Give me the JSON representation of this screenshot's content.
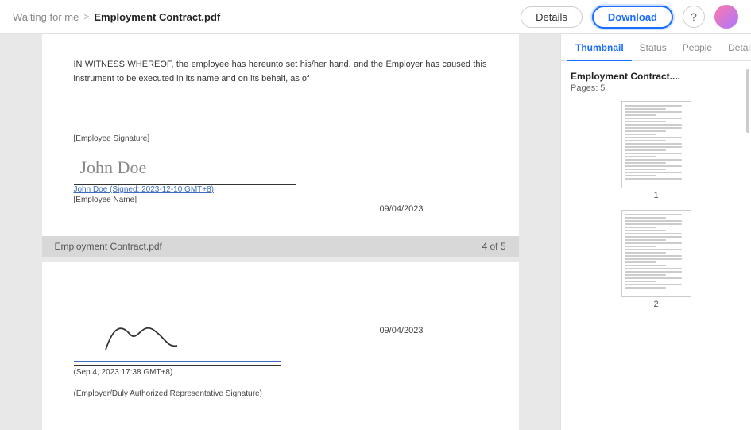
{
  "header": {
    "breadcrumb_waiting": "Waiting for me",
    "breadcrumb_sep": ">",
    "filename": "Employment Contract.pdf",
    "btn_details": "Details",
    "btn_download": "Download",
    "help_icon": "?",
    "tabs": [
      "Thumbnail",
      "Status",
      "People",
      "Details"
    ],
    "active_tab": "Thumbnail"
  },
  "thumbnail": {
    "title": "Employment Contract....",
    "pages_label": "Pages: 5",
    "page_numbers": [
      "1",
      "2"
    ]
  },
  "document": {
    "page4": {
      "intro_text": "IN WITNESS WHEREOF, the employee has hereunto set his/her hand, and the Employer has caused this instrument to be executed in its name and on its behalf, as of",
      "underline_placeholder": "________________________.",
      "employee_sig_label": "[Employee Signature]",
      "employee_name": "John Doe",
      "signed_text": "John Doe (Signed: 2023-12-10 GMT+8)",
      "employee_name_label": "[Employee Name]",
      "date_right": "09/04/2023",
      "footer_filename": "Employment Contract.pdf",
      "footer_pages": "4 of 5"
    },
    "page5": {
      "date_right": "09/04/2023",
      "sig_date_label": "(Sep 4, 2023 17:38 GMT+8)",
      "employer_sig_label": "(Employer/Duly Authorized Representative Signature)"
    }
  }
}
